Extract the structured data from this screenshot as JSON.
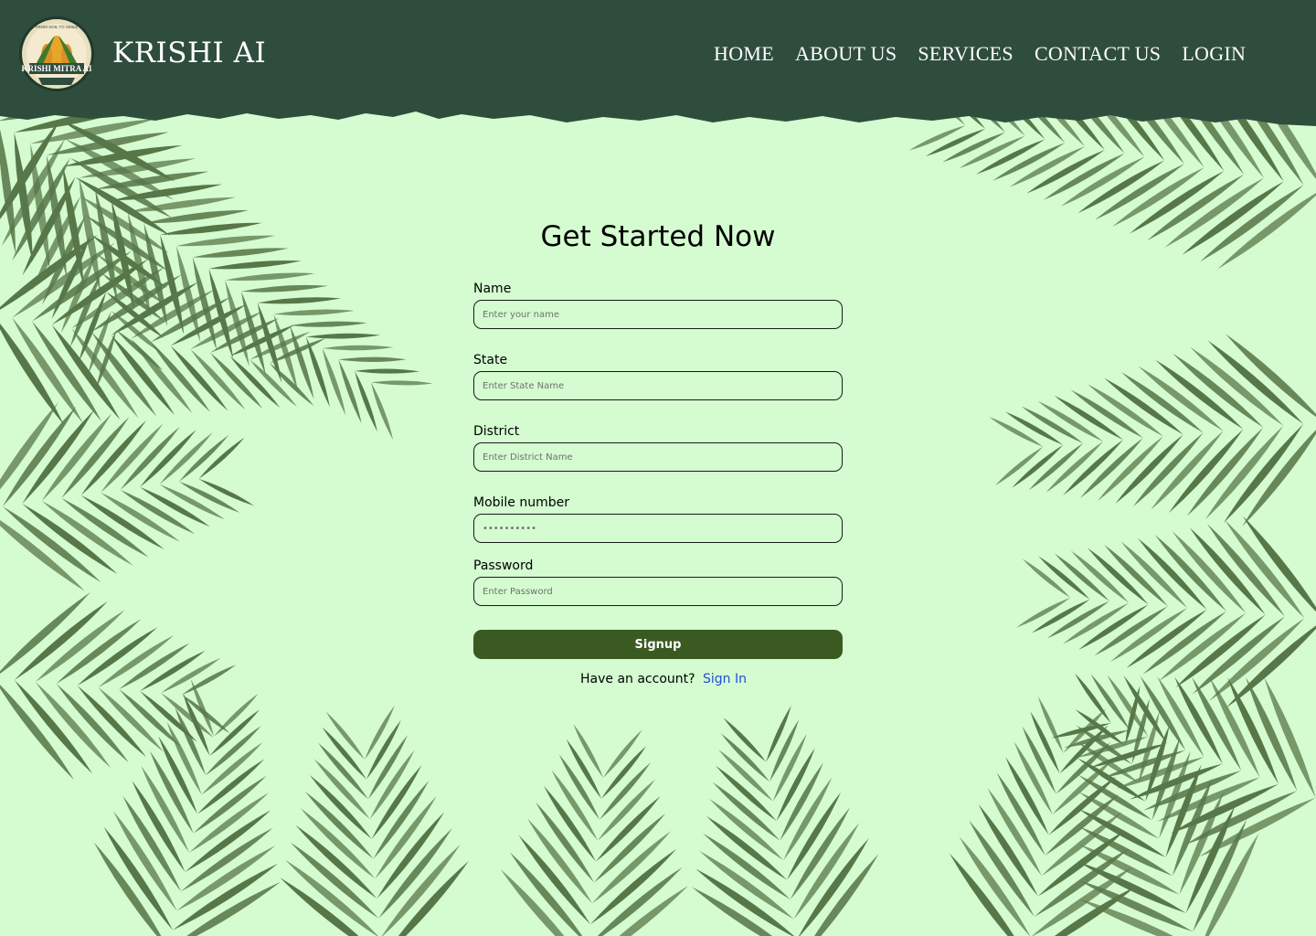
{
  "header": {
    "brand": "KRISHI AI",
    "logo": {
      "top_text": "FROM SOIL TO SMILE",
      "main_text": "KRISHI MITRA AI"
    },
    "nav": [
      "HOME",
      "ABOUT US",
      "SERVICES",
      "CONTACT US",
      "LOGIN"
    ]
  },
  "form": {
    "title": "Get Started Now",
    "fields": [
      {
        "label": "Name",
        "placeholder": "Enter your name",
        "type": "text"
      },
      {
        "label": "State",
        "placeholder": "Enter State Name",
        "type": "text"
      },
      {
        "label": "District",
        "placeholder": "Enter District Name",
        "type": "text"
      },
      {
        "label": "Mobile number",
        "placeholder": "••••••••••",
        "type": "text"
      },
      {
        "label": "Password",
        "placeholder": "Enter Password",
        "type": "password"
      }
    ],
    "submit_label": "Signup",
    "footer_text": "Have an account?",
    "signin_label": "Sign In"
  },
  "colors": {
    "background": "#d4fcd0",
    "header": "#2f4d3d",
    "button": "#3a5a22",
    "link": "#1f4fd8",
    "leaf": "#4d6b3c"
  }
}
